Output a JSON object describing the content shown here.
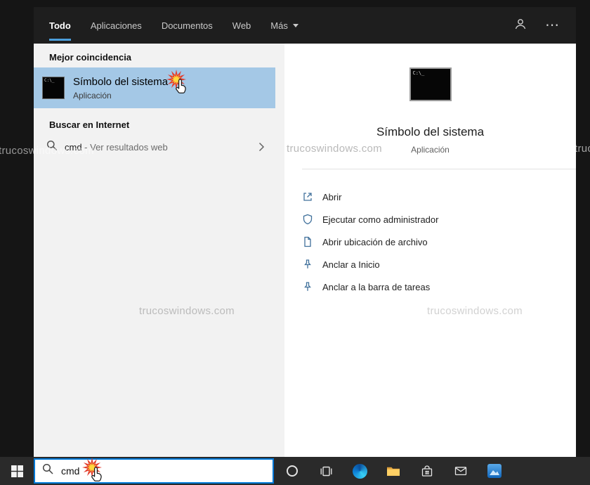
{
  "watermark": "trucoswindows.com",
  "window": {
    "tabs": [
      {
        "label": "Todo",
        "active": true
      },
      {
        "label": "Aplicaciones",
        "active": false
      },
      {
        "label": "Documentos",
        "active": false
      },
      {
        "label": "Web",
        "active": false
      },
      {
        "label": "Más",
        "active": false,
        "dropdown": true
      }
    ],
    "header": {
      "user_icon": "user-icon",
      "more_glyph": "⋯"
    },
    "left": {
      "best_match_header": "Mejor coincidencia",
      "best_match": {
        "title": "Símbolo del sistema",
        "subtitle": "Aplicación",
        "icon": "command-prompt-icon"
      },
      "web_header": "Buscar en Internet",
      "web_row": {
        "query": "cmd",
        "suffix": " - Ver resultados web",
        "icon": "search-icon",
        "chevron": "chevron-right-icon"
      }
    },
    "detail": {
      "title": "Símbolo del sistema",
      "subtitle": "Aplicación",
      "icon_prompt": "C:\\_",
      "actions": [
        {
          "label": "Abrir",
          "icon": "open-icon"
        },
        {
          "label": "Ejecutar como administrador",
          "icon": "shield-icon"
        },
        {
          "label": "Abrir ubicación de archivo",
          "icon": "document-icon"
        },
        {
          "label": "Anclar a Inicio",
          "icon": "pin-icon"
        },
        {
          "label": "Anclar a la barra de tareas",
          "icon": "pin-icon"
        }
      ]
    }
  },
  "taskbar": {
    "search_value": "cmd",
    "icons": [
      "start-icon",
      "cortana-icon",
      "task-view-icon",
      "edge-icon",
      "file-explorer-icon",
      "store-icon",
      "mail-icon",
      "photos-icon"
    ]
  },
  "colors": {
    "accent": "#0078d7",
    "tab_underline": "#4b9fdc",
    "selected_item_bg": "#a4c8e6",
    "header_bg": "#1e1e1e",
    "left_panel_bg": "#f2f2f2",
    "right_panel_bg": "#ffffff",
    "taskbar_bg": "#2a2a2a"
  }
}
